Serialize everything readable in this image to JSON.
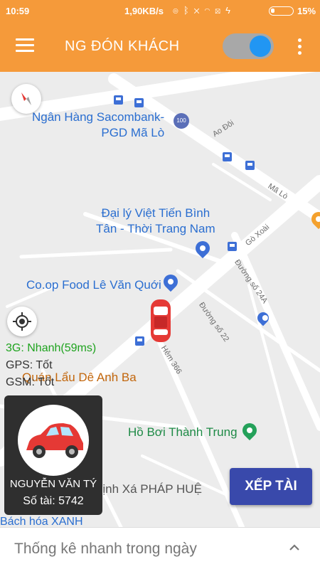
{
  "status_bar": {
    "time": "10:59",
    "network_speed": "1,90KB/s",
    "icons": [
      "alarm-icon",
      "bluetooth-icon",
      "vibrate-off-icon",
      "wifi-icon",
      "sim-icon",
      "charging-icon"
    ],
    "battery_level": 0.15,
    "battery_percent": "15%"
  },
  "app_bar": {
    "title": "NG ĐÓN KHÁCH",
    "menu_icon": "hamburger-menu-icon",
    "more_icon": "more-vertical-icon",
    "toggle_on": true,
    "color": "#f59a3a"
  },
  "map": {
    "places": {
      "sacombank": "Ngân Hàng Sacombank-\nPGD Mã Lò",
      "viet_tien": "Đại lý Việt Tiến Bình\nTân - Thời Trang Nam",
      "coop": "Co.op Food Lê Văn Quới",
      "lau_de": "Quán Lẩu Dê Anh Ba",
      "ho_boi": "Hồ Bơi Thành Trung",
      "tinh_xa": "Tịnh Xá PHÁP HUỆ",
      "bach_hoa": "Bách hóa XANH"
    },
    "streets": {
      "ao_doi": "Ao Đôi",
      "ma_lo": "Mã Lò",
      "go_xoai": "Gò Xoài",
      "duong_24a": "Đường số 24A",
      "duong_22": "Đường số 22",
      "hem_366": "Hẻm 366"
    },
    "route_badge": "100"
  },
  "connection_status": {
    "network": "3G: Nhanh(59ms)",
    "gps": "GPS: Tốt",
    "gsm": "GSM: Tốt"
  },
  "driver": {
    "name": "NGUYỄN VĂN TÝ",
    "vehicle_number": "Số tài: 5742"
  },
  "actions": {
    "queue_button": "XẾP TÀI"
  },
  "bottom_sheet": {
    "label": "Thống kê nhanh trong ngày",
    "icon": "chevron-up-icon"
  },
  "colors": {
    "accent": "#f59a3a",
    "button": "#3949ab",
    "toggle_knob": "#2196f3",
    "network_ok": "#1ea31e",
    "car": "#e53935"
  }
}
